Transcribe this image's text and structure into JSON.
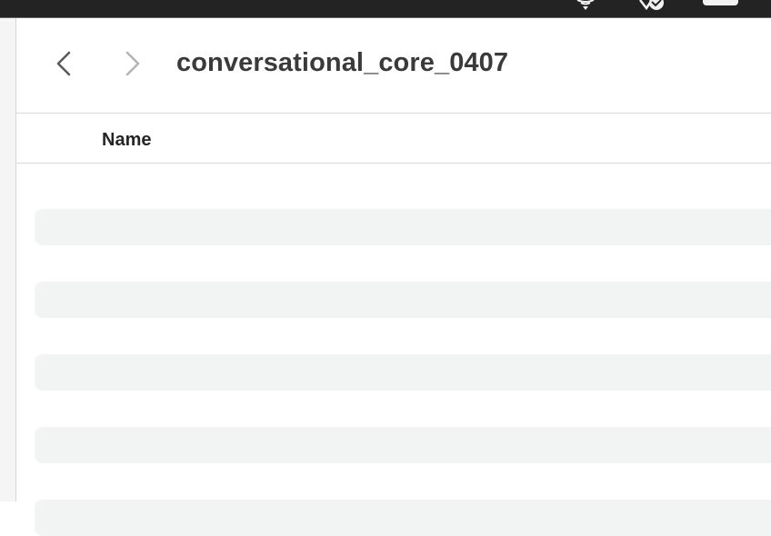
{
  "window": {
    "folder_title": "conversational_core_0407"
  },
  "table": {
    "columns": [
      {
        "label": "Name"
      }
    ],
    "loading_rows": 5
  },
  "icons": {
    "back": "chevron-left-icon",
    "forward": "chevron-right-icon",
    "wifi": "wifi-icon",
    "siri": "siri-icon",
    "battery": "battery-icon"
  },
  "colors": {
    "menubar": "#232323",
    "placeholder_row": "#f2f3f3",
    "title_text": "#3a3a3a",
    "chevron_enabled": "#5a5a5a",
    "chevron_disabled": "#b4b4b4"
  }
}
